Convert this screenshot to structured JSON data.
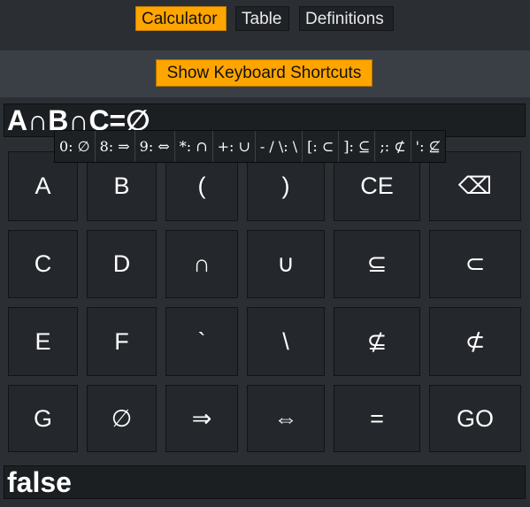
{
  "tabs": [
    {
      "label": "Calculator",
      "active": true
    },
    {
      "label": "Table",
      "active": false
    },
    {
      "label": "Definitions",
      "active": false
    }
  ],
  "shortcut_button": "Show Keyboard Shortcuts",
  "expression": "A∩B∩C=∅",
  "shortcuts": [
    "0: ∅",
    "8: ⇒",
    "9: ⇔",
    "*: ∩",
    "+: ∪",
    "- / \\: \\",
    "[: ⊂",
    "]: ⊆",
    ";: ⊄",
    "': ⊈"
  ],
  "keys": [
    [
      "A",
      "B",
      "(",
      ")",
      "CE",
      "⌫"
    ],
    [
      "C",
      "D",
      "∩",
      "∪",
      "⊆",
      "⊂"
    ],
    [
      "E",
      "F",
      "`",
      "\\",
      "⊈",
      "⊄"
    ],
    [
      "G",
      "∅",
      "⇒",
      "⇔",
      "=",
      "GO"
    ]
  ],
  "result": "false",
  "colors": {
    "accent": "#ffa500",
    "background": "#2b2e32",
    "key": "#24272b"
  }
}
